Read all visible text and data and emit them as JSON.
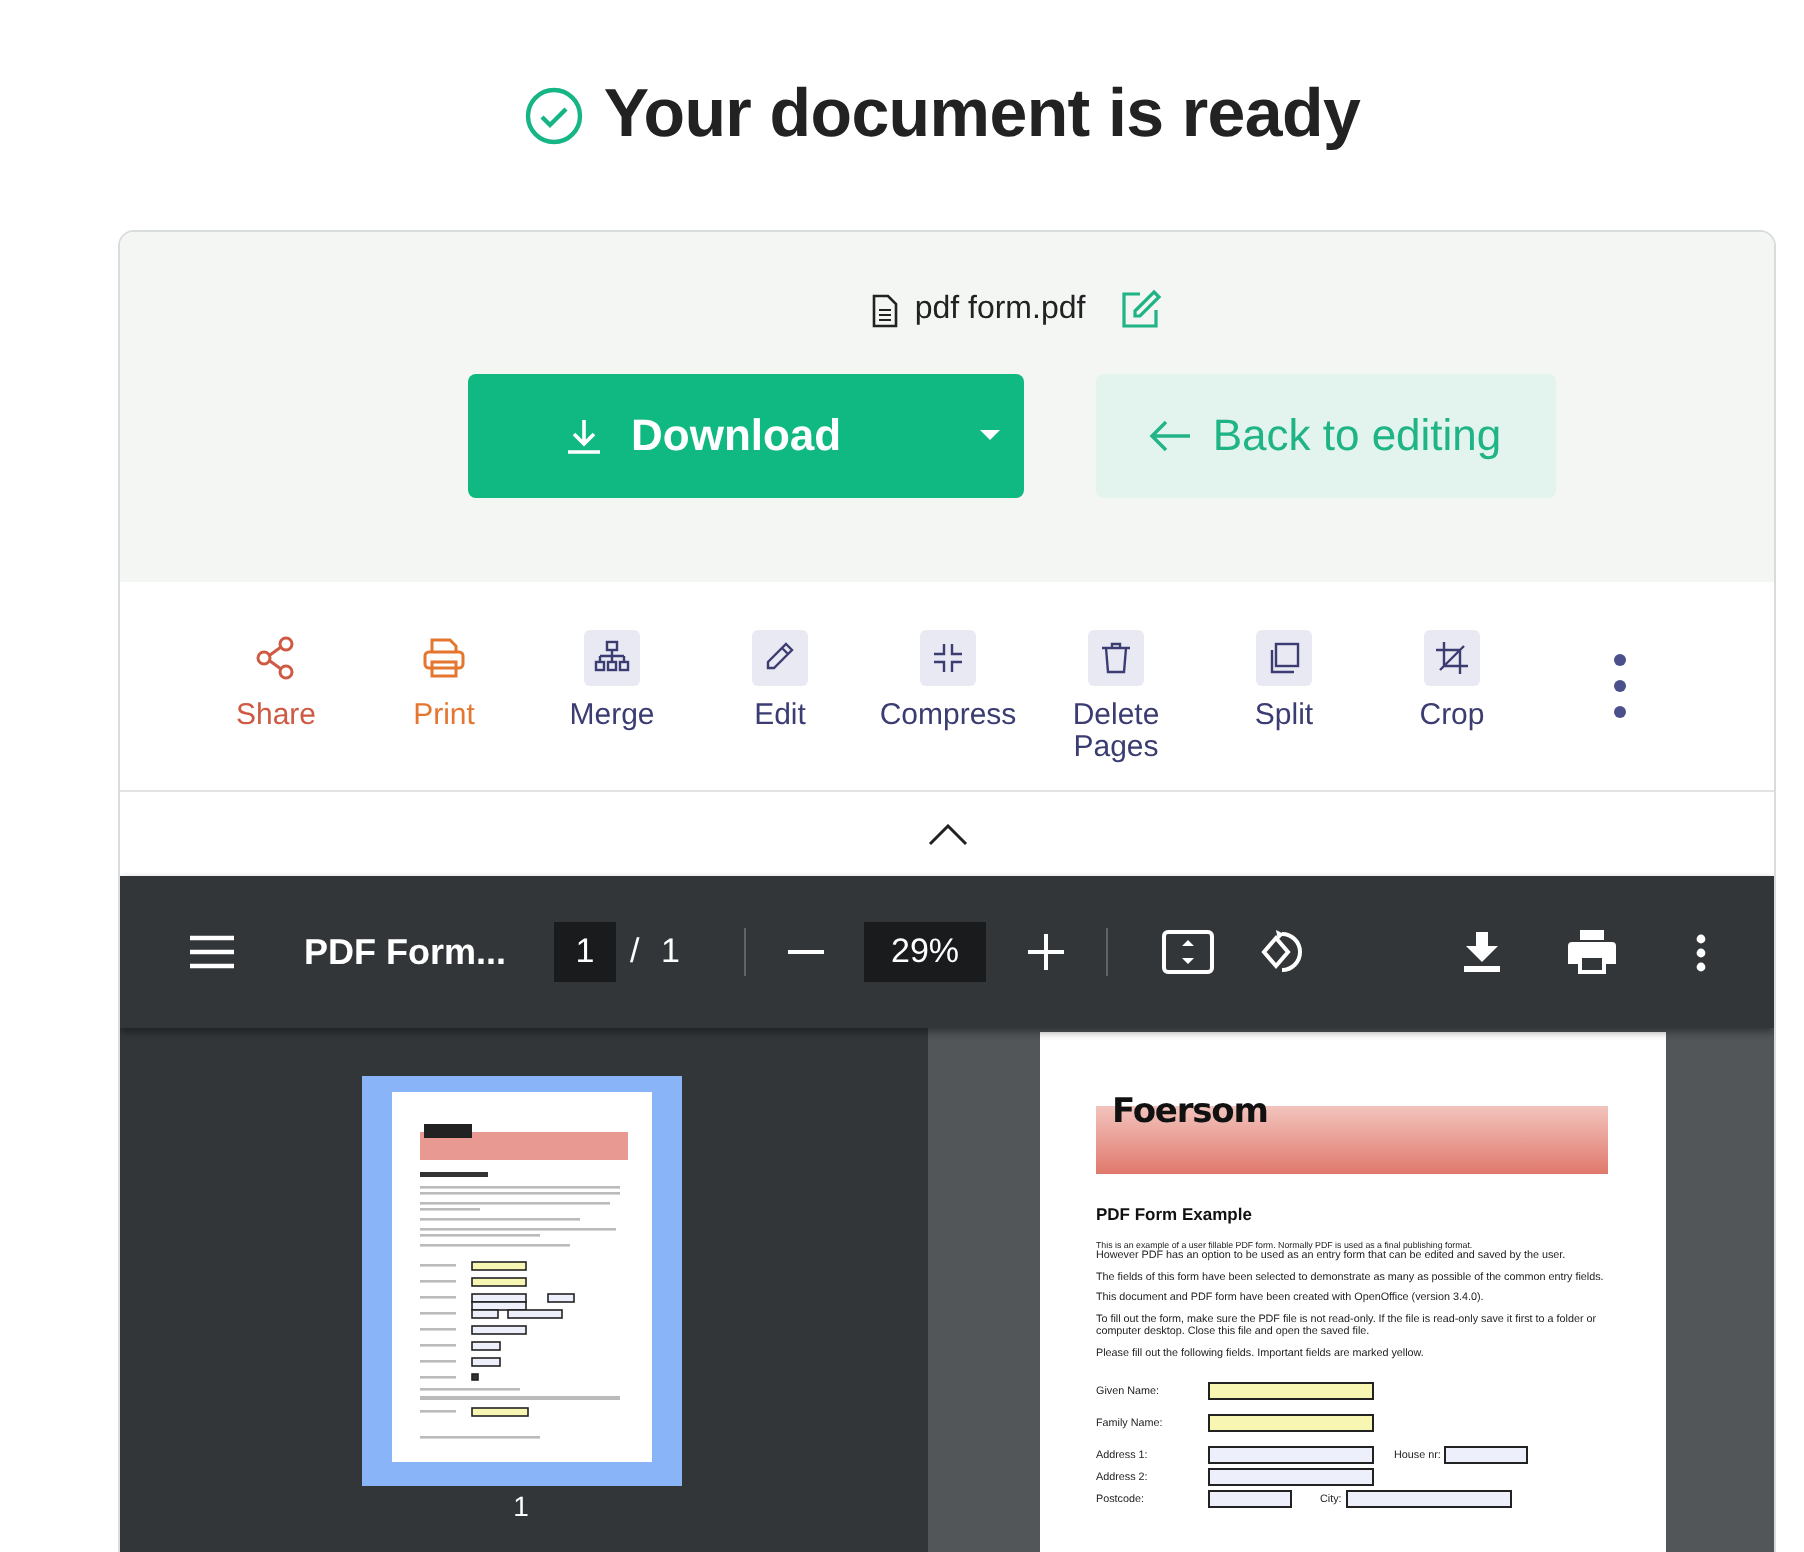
{
  "header": {
    "title": "Your document is ready"
  },
  "file": {
    "name": "pdf form.pdf"
  },
  "actions": {
    "download": "Download",
    "back": "Back to editing"
  },
  "tools": [
    {
      "label": "Share",
      "kind": "share",
      "accent": true,
      "color": "#cf5a43"
    },
    {
      "label": "Print",
      "kind": "print",
      "accent": true,
      "color": "#e4762f"
    },
    {
      "label": "Merge",
      "kind": "merge",
      "accent": false,
      "color": "#3b3d72"
    },
    {
      "label": "Edit",
      "kind": "edit",
      "accent": false,
      "color": "#3b3d72"
    },
    {
      "label": "Compress",
      "kind": "compress",
      "accent": false,
      "color": "#3b3d72"
    },
    {
      "label": "Delete Pages",
      "kind": "delete",
      "accent": false,
      "color": "#3b3d72"
    },
    {
      "label": "Split",
      "kind": "split",
      "accent": false,
      "color": "#3b3d72"
    },
    {
      "label": "Crop",
      "kind": "crop",
      "accent": false,
      "color": "#3b3d72"
    }
  ],
  "viewer": {
    "title": "PDF Form...",
    "page": "1",
    "page_total": "/ 1",
    "zoom": "29%"
  },
  "thumbnails": [
    {
      "page": "1",
      "selected": true
    }
  ],
  "document": {
    "logo": "Foersom",
    "heading": "PDF Form Example",
    "paragraphs": [
      "This is an example of a user fillable PDF form. Normally PDF is used as a final publishing format.",
      "However PDF has an option to be used as an entry form that can be edited and saved by the user.",
      "The fields of this form have been selected to demonstrate as many as possible of the common entry fields.",
      "This document and PDF form have been created with OpenOffice (version 3.4.0).",
      "To fill out the form, make sure the PDF file is not read-only. If the file is read-only save it first to a folder or computer desktop. Close this file and open the saved file.",
      "Please fill out the following fields. Important fields are marked yellow."
    ],
    "form_rows": [
      {
        "items": [
          {
            "kind": "label",
            "text": "Given Name:"
          },
          {
            "kind": "field",
            "color": "#f7f7b3"
          }
        ]
      },
      {
        "items": [
          {
            "kind": "label",
            "text": "Family Name:"
          },
          {
            "kind": "field",
            "color": "#f7f7b3"
          }
        ]
      },
      {
        "items": [
          {
            "kind": "label",
            "text": "Address 1:"
          },
          {
            "kind": "field",
            "color": "#edf0fb"
          },
          {
            "kind": "label",
            "text": "House nr:"
          },
          {
            "kind": "short",
            "color": "#edf0fb"
          }
        ]
      },
      {
        "items": [
          {
            "kind": "label",
            "text": "Address 2:"
          },
          {
            "kind": "field",
            "color": "#edf0fb"
          }
        ]
      },
      {
        "items": [
          {
            "kind": "label",
            "text": "Postcode:"
          },
          {
            "kind": "short",
            "color": "#edf0fb"
          },
          {
            "kind": "label",
            "text": "City:"
          },
          {
            "kind": "field",
            "color": "#edf0fb"
          }
        ]
      }
    ]
  }
}
